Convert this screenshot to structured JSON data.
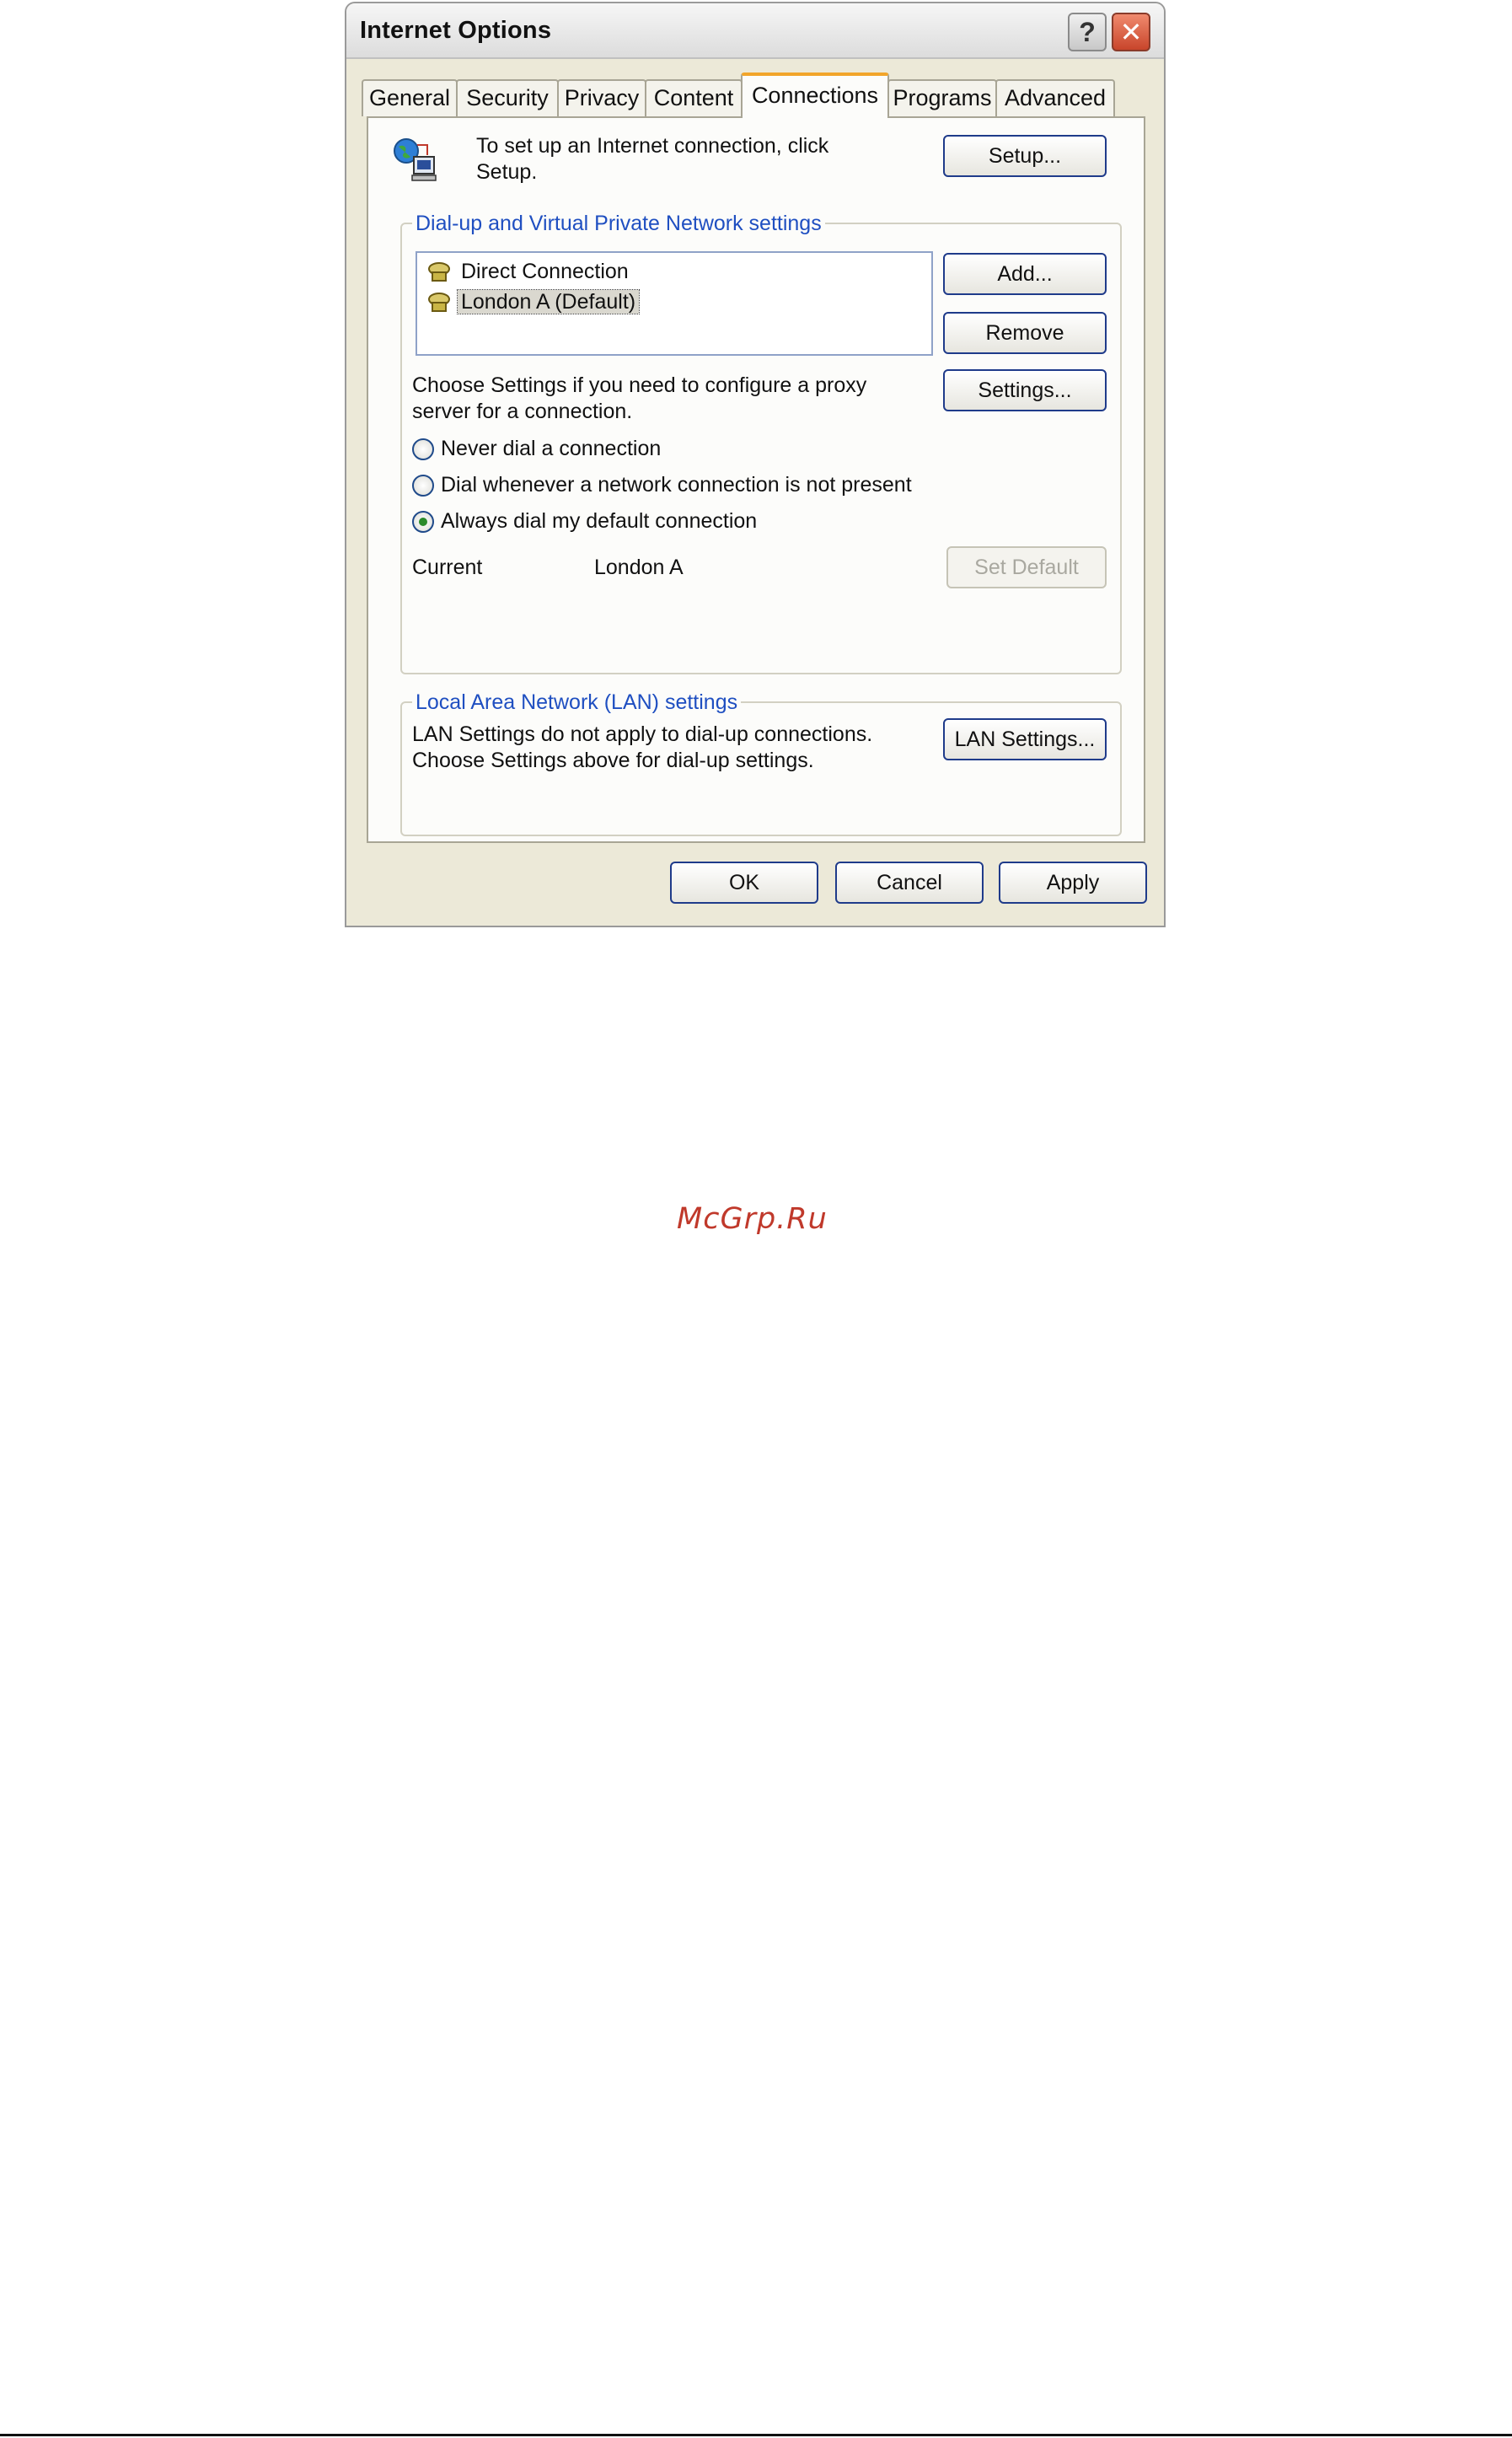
{
  "window": {
    "title": "Internet Options"
  },
  "titlebar": {
    "help_glyph": "?",
    "close_glyph": "✕"
  },
  "tabs": [
    {
      "label": "General",
      "active": false
    },
    {
      "label": "Security",
      "active": false
    },
    {
      "label": "Privacy",
      "active": false
    },
    {
      "label": "Content",
      "active": false
    },
    {
      "label": "Connections",
      "active": true
    },
    {
      "label": "Programs",
      "active": false
    },
    {
      "label": "Advanced",
      "active": false
    }
  ],
  "setup": {
    "text_line1": "To set up an Internet connection, click",
    "text_line2": "Setup.",
    "button_label": "Setup..."
  },
  "dialup": {
    "group_label": "Dial-up and Virtual Private Network settings",
    "connections": [
      {
        "label": "Direct Connection",
        "selected": false
      },
      {
        "label": "London A (Default)",
        "selected": true
      }
    ],
    "add_button": "Add...",
    "remove_button": "Remove",
    "settings_button": "Settings...",
    "proxy_text_line1": "Choose Settings if you need to configure a proxy",
    "proxy_text_line2": "server for a connection.",
    "options": [
      {
        "label": "Never dial a connection",
        "checked": false
      },
      {
        "label": "Dial whenever a network connection is not present",
        "checked": false
      },
      {
        "label": "Always dial my default connection",
        "checked": true
      }
    ],
    "current_label": "Current",
    "current_value": "London A",
    "set_default_button": "Set Default"
  },
  "lan": {
    "group_label": "Local Area Network (LAN) settings",
    "text_line1": "LAN Settings do not apply to dial-up connections.",
    "text_line2": "Choose Settings above for dial-up settings.",
    "button_label": "LAN Settings..."
  },
  "footer": {
    "ok": "OK",
    "cancel": "Cancel",
    "apply": "Apply"
  },
  "watermark": "McGrp.Ru",
  "colors": {
    "dialog_bg": "#ece9d8",
    "group_label": "#1f4fc1",
    "active_tab_accent": "#f2a52a",
    "close_button": "#c8452b"
  }
}
